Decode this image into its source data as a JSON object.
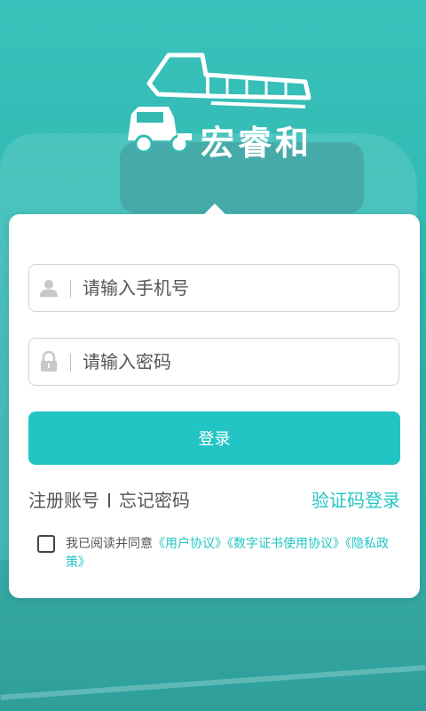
{
  "brand": {
    "name": "宏睿和"
  },
  "login": {
    "phone_placeholder": "请输入手机号",
    "password_placeholder": "请输入密码",
    "submit_label": "登录"
  },
  "links": {
    "register": "注册账号",
    "forgot_password": "忘记密码",
    "sms_login": "验证码登录"
  },
  "agreement": {
    "checked": false,
    "prefix": "我已阅读并同意",
    "user_agreement": "《用户协议》",
    "digital_cert_agreement": "《数字证书使用协议》",
    "privacy_policy": "《隐私政策》"
  },
  "icons": {
    "phone_field": "user-icon",
    "password_field": "lock-icon"
  },
  "colors": {
    "accent": "#22c5c4",
    "background": "#2fb9b3"
  }
}
